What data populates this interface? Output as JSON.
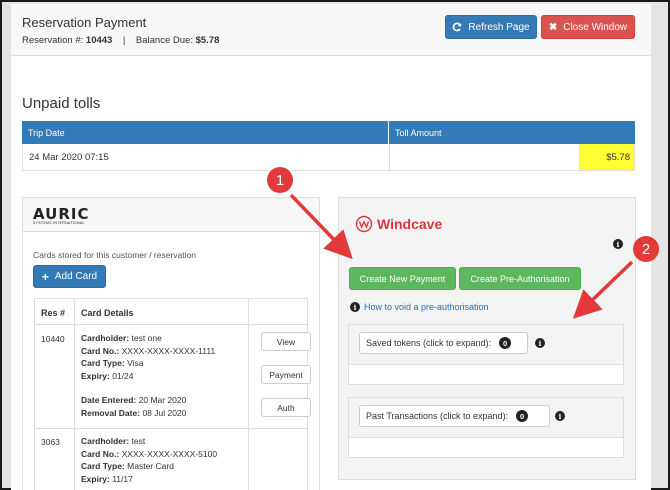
{
  "header": {
    "title": "Reservation Payment",
    "reservation_label": "Reservation #:",
    "reservation_number": "10443",
    "separator": "|",
    "balance_label": "Balance Due:",
    "balance_value": "$5.78",
    "refresh_label": "Refresh Page",
    "close_label": "Close Window"
  },
  "unpaid": {
    "title": "Unpaid tolls",
    "col_trip": "Trip Date",
    "col_amount": "Toll Amount",
    "rows": [
      {
        "trip_date": "24 Mar 2020 07:15",
        "amount": "$5.78"
      }
    ]
  },
  "auric": {
    "logo": "AURIC",
    "logo_sub": "SYSTEMS INTERNATIONAL",
    "cards_text": "Cards stored for this customer / reservation",
    "add_card_label": "Add Card",
    "col_res": "Res #",
    "col_details": "Card Details",
    "cards": [
      {
        "res": "10440",
        "cardholder_label": "Cardholder:",
        "cardholder": "test one",
        "cardno_label": "Card No.:",
        "cardno": "XXXX-XXXX-XXXX-1111",
        "type_label": "Card Type:",
        "type": "Visa",
        "expiry_label": "Expiry:",
        "expiry": "01/24",
        "entered_label": "Date Entered:",
        "entered": "20 Mar 2020",
        "removal_label": "Removal Date:",
        "removal": "08 Jul 2020",
        "view_label": "View",
        "payment_label": "Payment",
        "auth_label": "Auth"
      },
      {
        "res": "3063",
        "cardholder_label": "Cardholder:",
        "cardholder": "test",
        "cardno_label": "Card No.:",
        "cardno": "XXXX-XXXX-XXXX-5100",
        "type_label": "Card Type:",
        "type": "Master Card",
        "expiry_label": "Expiry:",
        "expiry": "11/17"
      }
    ]
  },
  "windcave": {
    "logo": "Windcave",
    "create_payment_label": "Create New Payment",
    "create_preauth_label": "Create Pre-Authorisation",
    "void_link": "How to void a pre-authorisation",
    "saved_tokens_label": "Saved tokens (click to expand):",
    "saved_tokens_count": "0",
    "past_tx_label": "Past Transactions (click to expand):",
    "past_tx_count": "0"
  },
  "annotations": {
    "one": "1",
    "two": "2"
  },
  "colors": {
    "primary": "#337ab7",
    "danger": "#d9534f",
    "success": "#5cb85c",
    "highlight": "#ffff33",
    "annotation": "#e23a3a"
  },
  "icons": [
    "refresh-icon",
    "close-icon",
    "plus-icon",
    "info-icon",
    "windcave-logo-icon"
  ]
}
